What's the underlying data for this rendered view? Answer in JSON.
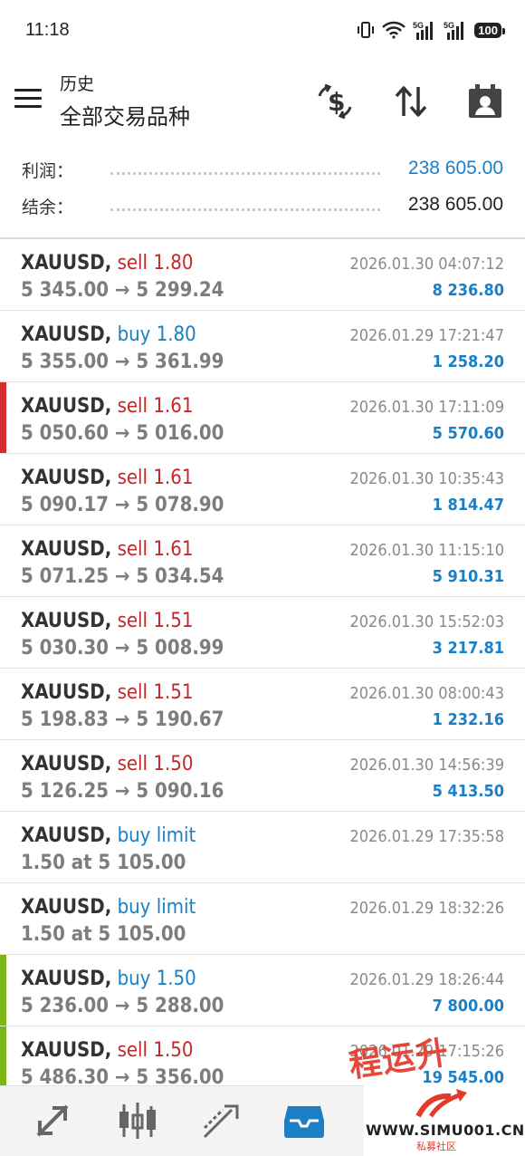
{
  "status_bar": {
    "time": "11:18",
    "battery": "100",
    "network_1": "5G",
    "network_2": "5G"
  },
  "header": {
    "subtitle": "历史",
    "title": "全部交易品种"
  },
  "summary": {
    "profit_label": "利润：",
    "profit_value": "238 605.00",
    "balance_label": "结余：",
    "balance_value": "238 605.00"
  },
  "trades": [
    {
      "symbol": "XAUUSD,",
      "side": "sell",
      "volume": "1.80",
      "prices": "5 345.00 → 5 299.24",
      "date": "2026.01.30 04:07:12",
      "profit": "8 236.80",
      "accent": ""
    },
    {
      "symbol": "XAUUSD,",
      "side": "buy",
      "volume": "1.80",
      "prices": "5 355.00 → 5 361.99",
      "date": "2026.01.29 17:21:47",
      "profit": "1 258.20",
      "accent": ""
    },
    {
      "symbol": "XAUUSD,",
      "side": "sell",
      "volume": "1.61",
      "prices": "5 050.60 → 5 016.00",
      "date": "2026.01.30 17:11:09",
      "profit": "5 570.60",
      "accent": "#d32f2f"
    },
    {
      "symbol": "XAUUSD,",
      "side": "sell",
      "volume": "1.61",
      "prices": "5 090.17 → 5 078.90",
      "date": "2026.01.30 10:35:43",
      "profit": "1 814.47",
      "accent": ""
    },
    {
      "symbol": "XAUUSD,",
      "side": "sell",
      "volume": "1.61",
      "prices": "5 071.25 → 5 034.54",
      "date": "2026.01.30 11:15:10",
      "profit": "5 910.31",
      "accent": ""
    },
    {
      "symbol": "XAUUSD,",
      "side": "sell",
      "volume": "1.51",
      "prices": "5 030.30 → 5 008.99",
      "date": "2026.01.30 15:52:03",
      "profit": "3 217.81",
      "accent": ""
    },
    {
      "symbol": "XAUUSD,",
      "side": "sell",
      "volume": "1.51",
      "prices": "5 198.83 → 5 190.67",
      "date": "2026.01.30 08:00:43",
      "profit": "1 232.16",
      "accent": ""
    },
    {
      "symbol": "XAUUSD,",
      "side": "sell",
      "volume": "1.50",
      "prices": "5 126.25 → 5 090.16",
      "date": "2026.01.30 14:56:39",
      "profit": "5 413.50",
      "accent": ""
    },
    {
      "symbol": "XAUUSD,",
      "side": "buy",
      "volume": "limit",
      "prices": "1.50 at 5 105.00",
      "date": "2026.01.29 17:35:58",
      "profit": "",
      "accent": ""
    },
    {
      "symbol": "XAUUSD,",
      "side": "buy",
      "volume": "limit",
      "prices": "1.50 at 5 105.00",
      "date": "2026.01.29 18:32:26",
      "profit": "",
      "accent": ""
    },
    {
      "symbol": "XAUUSD,",
      "side": "buy",
      "volume": "1.50",
      "prices": "5 236.00 → 5 288.00",
      "date": "2026.01.29 18:26:44",
      "profit": "7 800.00",
      "accent": "#7cb518"
    },
    {
      "symbol": "XAUUSD,",
      "side": "sell",
      "volume": "1.50",
      "prices": "5 486.30 → 5 356.00",
      "date": "2026.01.29 17:15:26",
      "profit": "19 545.00",
      "accent": "#7cb518"
    }
  ],
  "watermark": {
    "text": "程运升",
    "site": "WWW.SIMU001.CN",
    "site_sub": "私募社区"
  },
  "bottom_nav": [
    {
      "icon": "quotes-icon"
    },
    {
      "icon": "chart-icon"
    },
    {
      "icon": "trade-icon"
    },
    {
      "icon": "history-icon",
      "active": true
    },
    {
      "icon": "messages-icon"
    }
  ],
  "colors": {
    "accent_blue": "#1b7fc6",
    "sell_red": "#c62828",
    "buy_blue": "#1b7fc6"
  }
}
